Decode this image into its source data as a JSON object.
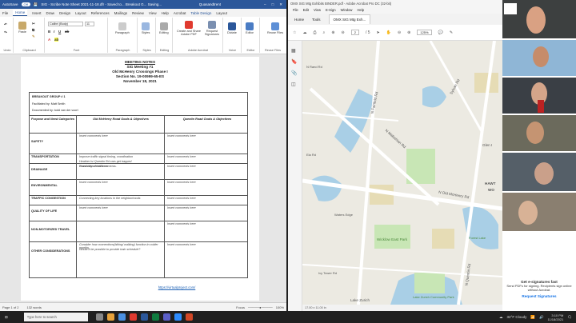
{
  "word": {
    "autosave": "AutoSave",
    "autosave_state": "Off",
    "title": "SIG - Scribe Note Sheet 2021-11-18.dfr - Saved to... Breakout G... Saving...",
    "user": "Quasandtrent",
    "tabs": [
      "File",
      "Home",
      "Insert",
      "Draw",
      "Design",
      "Layout",
      "References",
      "Mailings",
      "Review",
      "View",
      "Help",
      "Acrobat",
      "Table Design",
      "Layout"
    ],
    "font_name": "Calibri (Body)",
    "font_size": "11",
    "groups": [
      "Undo",
      "Clipboard",
      "Font",
      "Paragraph",
      "Styles",
      "Editing",
      "Adobe Acrobat",
      "Voice",
      "Editor",
      "Reuse Files"
    ],
    "buttons": {
      "paste": "Paste",
      "paragraph": "Paragraph",
      "styles": "Styles",
      "editing": "Editing",
      "create_share": "Create and Share Adobe PDF",
      "request_sig": "Request Signatures",
      "dictate": "Dictate",
      "editor": "Editor",
      "reuse": "Reuse Files"
    },
    "doc": {
      "h1": "MEETING NOTES",
      "h2": "SIG Meeting #1",
      "h3": "Old McHenry Crossings Phase I",
      "h4": "Section No. 19-00999-65-ES",
      "h5": "November 18, 2021",
      "group": "BREAKOUT GROUP # 1",
      "facilitated": "Facilitated by: Matt Smith",
      "documented": "Documented by: todd van der voort",
      "col1": "Purpose and Need Categories",
      "col2": "Old McHenry Road Goals & Objectives",
      "col3": "Quentin Road Goals & Objectives",
      "rows": [
        {
          "cat": "SAFETY",
          "a": [
            "Insert comments here"
          ],
          "b": [
            "Insert comments here"
          ]
        },
        {
          "cat": "TRANSPORTATION",
          "a": [
            "Improve traffic signal timing, coordination",
            "Heather Is/ Quentin Rd cars get trapped",
            "Possibility of traffic cameras."
          ],
          "b": [
            "Insert comments here"
          ]
        },
        {
          "cat": "DRAINAGE",
          "a": [
            "Insert comments here"
          ],
          "b": [
            "Insert comments here"
          ]
        },
        {
          "cat": "ENVIRONMENTAL",
          "a": [
            "Insert comments here"
          ],
          "b": [
            "Insert comments here"
          ]
        },
        {
          "cat": "TRAFFIC CONGESTION",
          "a": [
            "Connecting key locations in the neighborhoods"
          ],
          "b": [
            "Insert comments here"
          ]
        },
        {
          "cat": "QUALITY OF LIFE",
          "a": [
            "Insert comments here"
          ],
          "b": [
            "Insert comments here"
          ]
        },
        {
          "cat": "NON-MOTORIZED TRAVEL",
          "a": [
            ""
          ],
          "b": [
            "Insert comments here"
          ]
        },
        {
          "cat": "OTHER CONSIDERATIONS",
          "a": [
            "Consider how connections(biking/ walking) function in colder months",
            "Would it be possible to provide train schedule?"
          ],
          "b": [
            "Insert comments here"
          ]
        }
      ],
      "link": "https://virtualproject.com/"
    },
    "status": {
      "page": "Page 1 of 2",
      "words": "132 words",
      "focus": "Focus",
      "zoom": "100%"
    }
  },
  "acrobat": {
    "title": "OMX SIG Mtg Exhibits BINDER.pdf - Adobe Acrobat Pro DC (32-bit)",
    "menu": [
      "File",
      "Edit",
      "View",
      "E-Sign",
      "Window",
      "Help"
    ],
    "tabs": [
      "Home",
      "Tools",
      "OMX SIG Mtg Exh..."
    ],
    "page_num": "2",
    "page_total": "/ 5",
    "zoom": "125%",
    "size": "17.00 x 11.00 in",
    "map_labels": [
      "N Fairfield Rd",
      "N Midlothian Rd",
      "Sylvan Rd",
      "N Old McHenry Rd",
      "Glen I",
      "HAWT",
      "WO",
      "Wicklow East Park",
      "N Quentin Rd",
      "Lake Zurich",
      "Lake Zurich Community Park",
      "Ela Rd",
      "Forest Lake",
      "Ivy Tower Rd",
      "N Rand Rd",
      "Waters Edge"
    ],
    "promo_title": "Get e-signatures fast",
    "promo_text": "Send PDFs for signing. Recipients sign online without Acrobat.",
    "promo_link": "Request Signatures"
  },
  "taskbar": {
    "search": "Type here to search",
    "weather": "32°F Cloudy",
    "time": "3:10 PM",
    "date": "11/18/2021"
  }
}
